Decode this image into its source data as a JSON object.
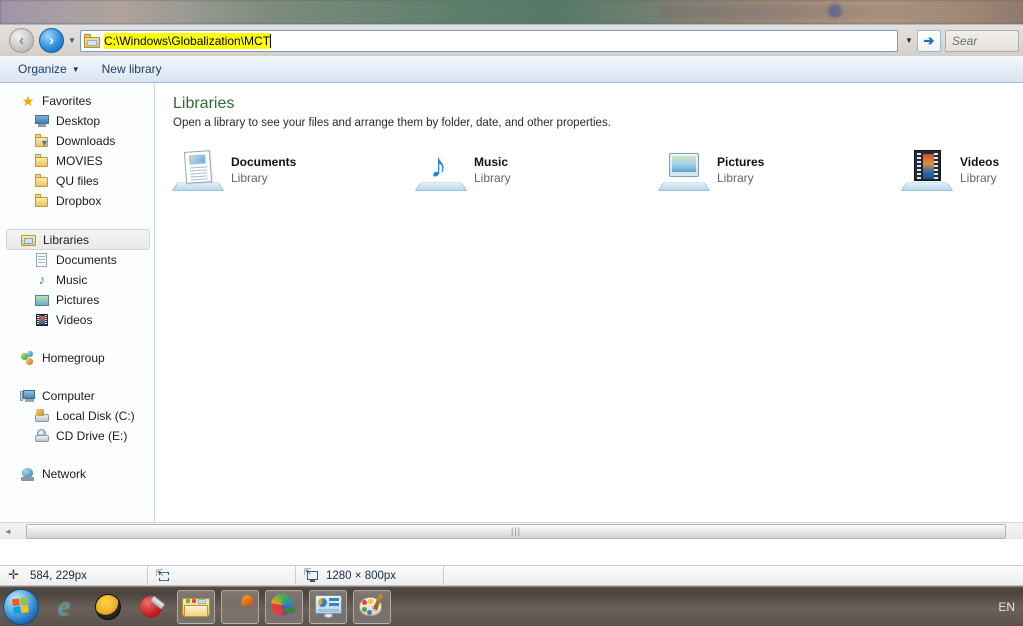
{
  "address_bar": {
    "back_icon": "back-arrow-icon",
    "forward_icon": "forward-arrow-icon",
    "recent_caret": "▼",
    "path_value": "C:\\Windows\\Globalization\\MCT",
    "dropdown_caret": "▼",
    "go_arrow": "➔",
    "search_placeholder": "Sear"
  },
  "toolbar": {
    "organize_label": "Organize",
    "organize_caret": "▼",
    "new_library_label": "New library"
  },
  "sidebar": {
    "groups": [
      {
        "header": {
          "label": "Favorites",
          "icon": "star-icon"
        },
        "items": [
          {
            "label": "Desktop",
            "icon": "monitor-icon"
          },
          {
            "label": "Downloads",
            "icon": "downloads-folder-icon"
          },
          {
            "label": "MOVIES",
            "icon": "folder-icon"
          },
          {
            "label": "QU files",
            "icon": "folder-icon"
          },
          {
            "label": "Dropbox",
            "icon": "folder-icon"
          }
        ]
      },
      {
        "header": {
          "label": "Libraries",
          "icon": "libraries-icon",
          "selected": true
        },
        "items": [
          {
            "label": "Documents",
            "icon": "document-icon"
          },
          {
            "label": "Music",
            "icon": "music-note-icon"
          },
          {
            "label": "Pictures",
            "icon": "picture-icon"
          },
          {
            "label": "Videos",
            "icon": "video-icon"
          }
        ]
      },
      {
        "header": {
          "label": "Homegroup",
          "icon": "homegroup-icon"
        },
        "items": []
      },
      {
        "header": {
          "label": "Computer",
          "icon": "computer-icon"
        },
        "items": [
          {
            "label": "Local Disk (C:)",
            "icon": "hard-disk-icon"
          },
          {
            "label": "CD Drive (E:)",
            "icon": "cd-drive-icon"
          }
        ]
      },
      {
        "header": {
          "label": "Network",
          "icon": "network-icon"
        },
        "items": []
      }
    ]
  },
  "content": {
    "title": "Libraries",
    "subtitle": "Open a library to see your files and arrange them by folder, date, and other properties.",
    "title_color": "#2f6b34",
    "libraries": [
      {
        "name": "Documents",
        "kind": "Library",
        "icon": "documents-library-icon"
      },
      {
        "name": "Music",
        "kind": "Library",
        "icon": "music-library-icon"
      },
      {
        "name": "Pictures",
        "kind": "Library",
        "icon": "pictures-library-icon"
      },
      {
        "name": "Videos",
        "kind": "Library",
        "icon": "videos-library-icon"
      }
    ]
  },
  "scrollbar": {
    "left_arrow": "◄",
    "grip": "|||"
  },
  "statusbar": {
    "cursor_icon": "move-crosshair-icon",
    "cursor_position": "584, 229px",
    "selection_icon": "selection-size-icon",
    "selection_value": "",
    "image_icon": "image-size-icon",
    "image_size": "1280 × 800px"
  },
  "taskbar": {
    "start_label": "Start",
    "items": [
      {
        "icon": "internet-explorer-icon",
        "pinned": false
      },
      {
        "icon": "norton-icon",
        "pinned": false
      },
      {
        "icon": "ccleaner-icon",
        "pinned": false
      },
      {
        "icon": "windows-explorer-icon",
        "pinned": true
      },
      {
        "icon": "firefox-icon",
        "pinned": true
      },
      {
        "icon": "internet-download-manager-icon",
        "pinned": true
      },
      {
        "icon": "control-panel-icon",
        "pinned": true
      },
      {
        "icon": "paint-icon",
        "pinned": true
      }
    ],
    "language": "EN"
  }
}
